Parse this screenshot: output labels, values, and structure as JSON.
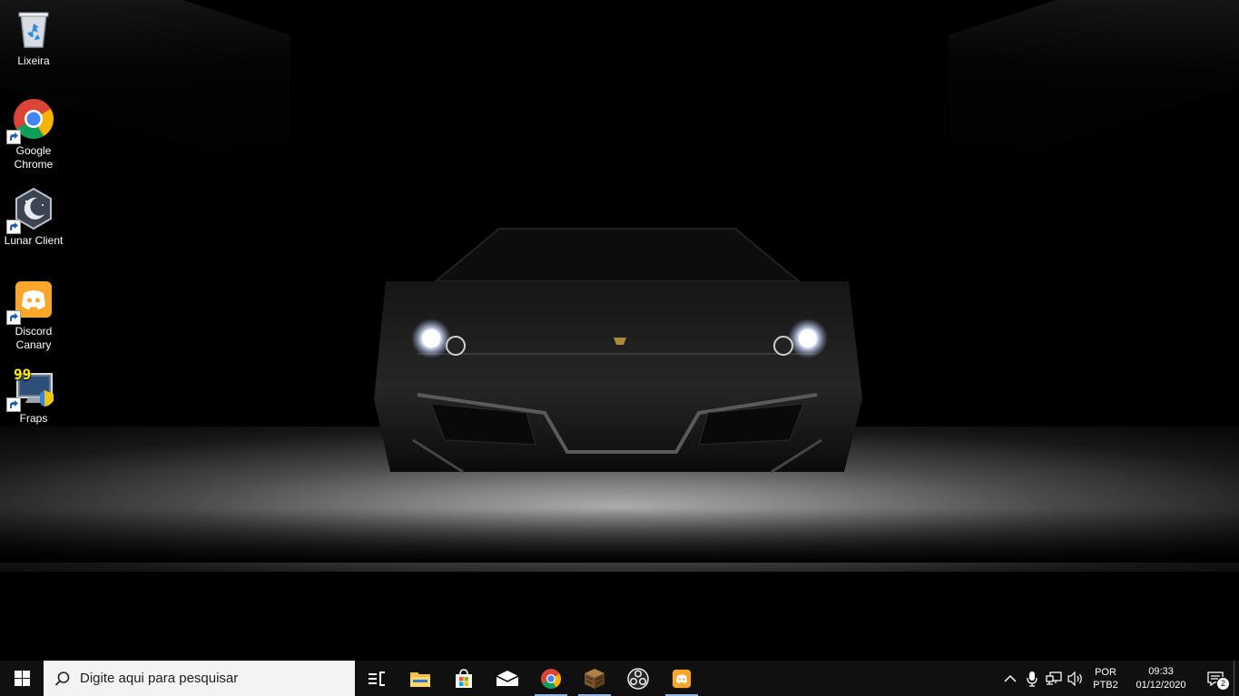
{
  "desktop": {
    "icons": [
      {
        "label": "Lixeira",
        "icon": "recycle-bin-icon",
        "shortcut": false
      },
      {
        "label": "Google Chrome",
        "icon": "chrome-icon",
        "shortcut": true
      },
      {
        "label": "Lunar Client",
        "icon": "lunar-client-icon",
        "shortcut": true
      },
      {
        "label": "Discord Canary",
        "icon": "discord-canary-icon",
        "shortcut": true
      },
      {
        "label": "Fraps",
        "icon": "fraps-icon",
        "shortcut": true
      }
    ],
    "fraps_counter": "99",
    "wallpaper": "dark sports car in a spotlit garage"
  },
  "taskbar": {
    "search_placeholder": "Digite aqui para pesquisar",
    "pinned": [
      {
        "name": "task-view",
        "icon": "task-view-icon"
      },
      {
        "name": "file-explorer",
        "icon": "folder-icon"
      },
      {
        "name": "microsoft-store",
        "icon": "store-icon"
      },
      {
        "name": "mail",
        "icon": "mail-icon"
      },
      {
        "name": "chrome",
        "icon": "chrome-icon",
        "active": true
      },
      {
        "name": "minecraft",
        "icon": "minecraft-icon",
        "active": true
      },
      {
        "name": "obs",
        "icon": "obs-icon"
      },
      {
        "name": "discord-canary",
        "icon": "discord-canary-icon",
        "active": true
      }
    ],
    "tray": {
      "language_line1": "POR",
      "language_line2": "PTB2",
      "time": "09:33",
      "date": "01/12/2020",
      "notification_count": "2"
    }
  },
  "colors": {
    "taskbar": "#101010",
    "search_box": "#f3f3f3",
    "active_indicator": "#8fb8e0",
    "discord_canary": "#f9a62b"
  }
}
